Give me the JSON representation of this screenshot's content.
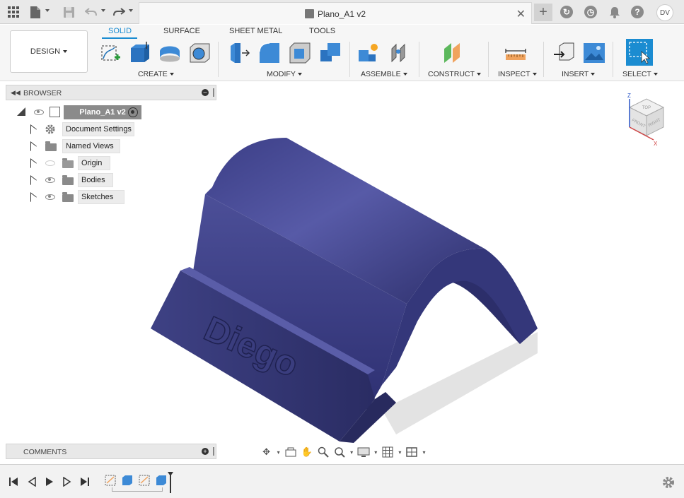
{
  "window": {
    "title": "Plano_A1 v2",
    "close_glyph": "✕",
    "user_initials": "DV"
  },
  "toolbar": {
    "design_label": "DESIGN",
    "tabs": [
      "SOLID",
      "SURFACE",
      "SHEET METAL",
      "TOOLS"
    ],
    "active_tab": "SOLID",
    "groups": [
      "CREATE",
      "MODIFY",
      "ASSEMBLE",
      "CONSTRUCT",
      "INSPECT",
      "INSERT",
      "SELECT"
    ]
  },
  "browser": {
    "header": "BROWSER",
    "root": "Plano_A1 v2",
    "items": [
      {
        "label": "Document Settings",
        "icon": "gear-icon"
      },
      {
        "label": "Named Views",
        "icon": "folder-icon"
      },
      {
        "label": "Origin",
        "icon": "folder-icon"
      },
      {
        "label": "Bodies",
        "icon": "folder-icon"
      },
      {
        "label": "Sketches",
        "icon": "folder-icon"
      }
    ]
  },
  "comments": {
    "header": "COMMENTS"
  },
  "viewcube": {
    "top": "TOP",
    "front": "FRONT",
    "right": "RIGHT",
    "axis_z": "Z",
    "axis_x": "X"
  },
  "model": {
    "engraved_text": "Diego"
  },
  "colors": {
    "accent": "#1b8cd1",
    "model": "#3a3d7e"
  }
}
